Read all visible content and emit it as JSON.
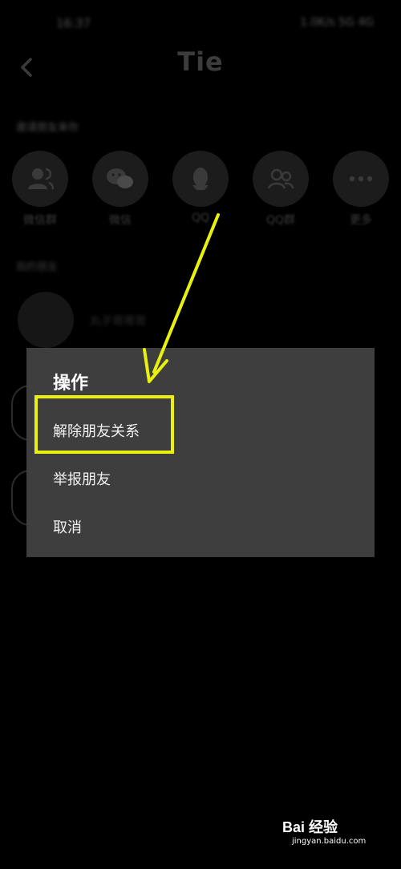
{
  "status_bar": {
    "time": "16:37",
    "indicators": "1.0K/s 5G 4G"
  },
  "header": {
    "title": "Tie",
    "back_icon": "chevron-left-icon"
  },
  "share_section": {
    "caption": "邀请朋友来你",
    "items": [
      {
        "label": "微信群",
        "icon": "group-chat-icon"
      },
      {
        "label": "微信",
        "icon": "wechat-icon"
      },
      {
        "label": "QQ",
        "icon": "qq-penguin-icon"
      },
      {
        "label": "QQ群",
        "icon": "qq-group-icon"
      },
      {
        "label": "更多",
        "icon": "more-dots-icon"
      }
    ]
  },
  "friends_section": {
    "caption": "我的朋友",
    "first_friend": "丸子哥哥哥"
  },
  "dialog": {
    "title": "操作",
    "items": [
      {
        "label": "解除朋友关系"
      },
      {
        "label": "举报朋友"
      },
      {
        "label": "取消"
      }
    ]
  },
  "annotation": {
    "highlight_color": "#e9f10c"
  },
  "watermark": {
    "brand": "Bai 经验",
    "url": "jingyan.baidu.com"
  }
}
